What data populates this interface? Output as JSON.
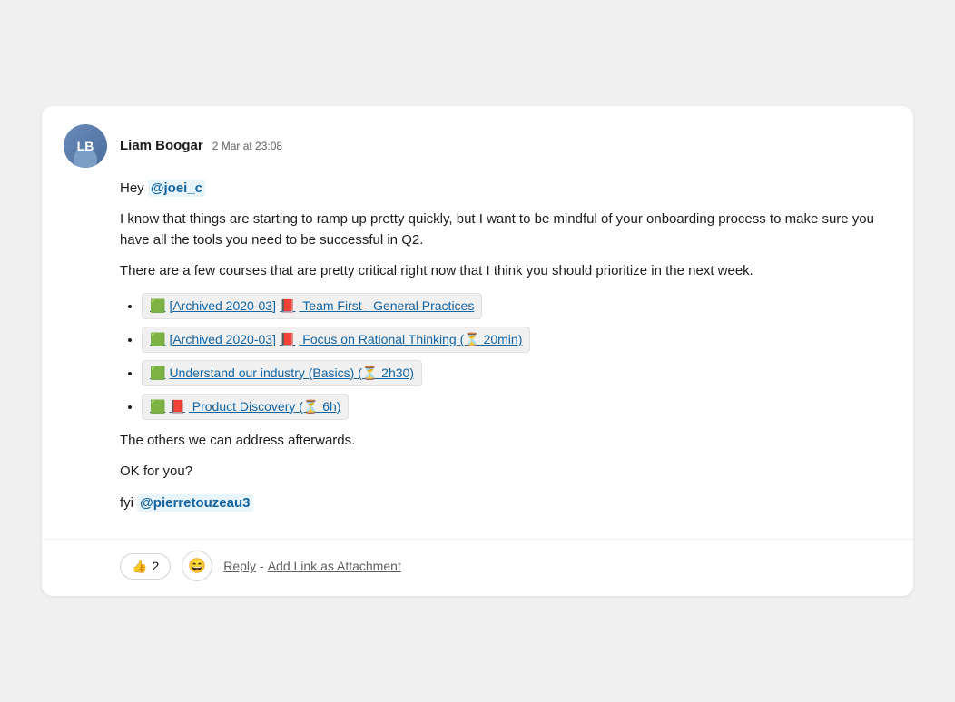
{
  "message": {
    "author": "Liam Boogar",
    "timestamp": "2 Mar at 23:08",
    "avatar_initials": "LB",
    "body": {
      "greeting": "Hey",
      "mention1": "@joei_c",
      "paragraph1": "I know that things are starting to ramp up pretty quickly, but I want to be mindful of your onboarding process to make sure you have all the tools you need to be successful in Q2.",
      "paragraph2": "There are a few courses that are pretty critical right now that I think you should prioritize in the next week.",
      "courses": [
        {
          "icon1": "🟩",
          "icon2": "📕",
          "text": "[Archived 2020-03] 📕  Team First - General Practices"
        },
        {
          "icon1": "🟩",
          "icon2": "📕",
          "text": "[Archived 2020-03] 📕  Focus on Rational Thinking (⏳ 20min)"
        },
        {
          "icon1": "🟩",
          "text": "Understand our industry (Basics) (⏳ 2h30)"
        },
        {
          "icon1": "🟩",
          "icon2": "📕",
          "text": "📕  Product Discovery (⏳ 6h)"
        }
      ],
      "paragraph3": "The others we can address afterwards.",
      "paragraph4": "OK for you?",
      "fyi_text": "fyi",
      "mention2": "@pierretouzeau3"
    },
    "footer": {
      "reaction_emoji": "👍",
      "reaction_count": "2",
      "emoji_picker_icon": "😄",
      "reply_label": "Reply",
      "separator": "-",
      "add_link_label": "Add Link as Attachment"
    }
  }
}
